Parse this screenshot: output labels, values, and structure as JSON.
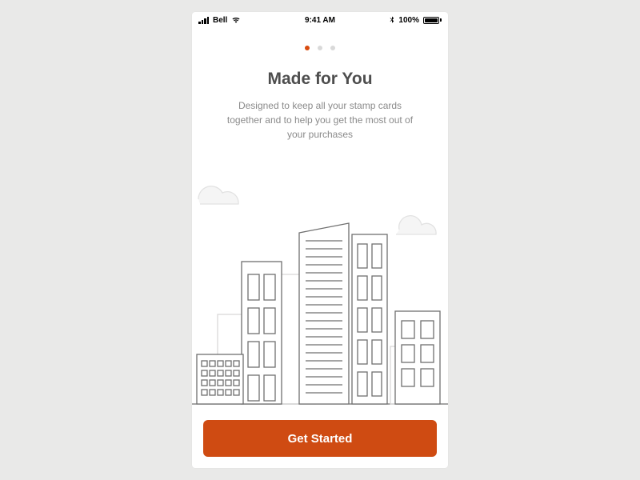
{
  "status_bar": {
    "carrier": "Bell",
    "time": "9:41 AM",
    "battery_pct": "100%"
  },
  "pager": {
    "count": 3,
    "active_index": 0
  },
  "onboarding": {
    "title": "Made for You",
    "subtitle": "Designed to keep all your stamp cards together and to help you get the most out of your purchases"
  },
  "cta": {
    "label": "Get Started"
  },
  "colors": {
    "accent": "#cf4b12",
    "dot_active": "#d84b0f",
    "dot_inactive": "#d9d9d9"
  },
  "icons": {
    "signal": "signal-bars-icon",
    "wifi": "wifi-icon",
    "bluetooth": "bluetooth-icon",
    "battery": "battery-icon"
  }
}
